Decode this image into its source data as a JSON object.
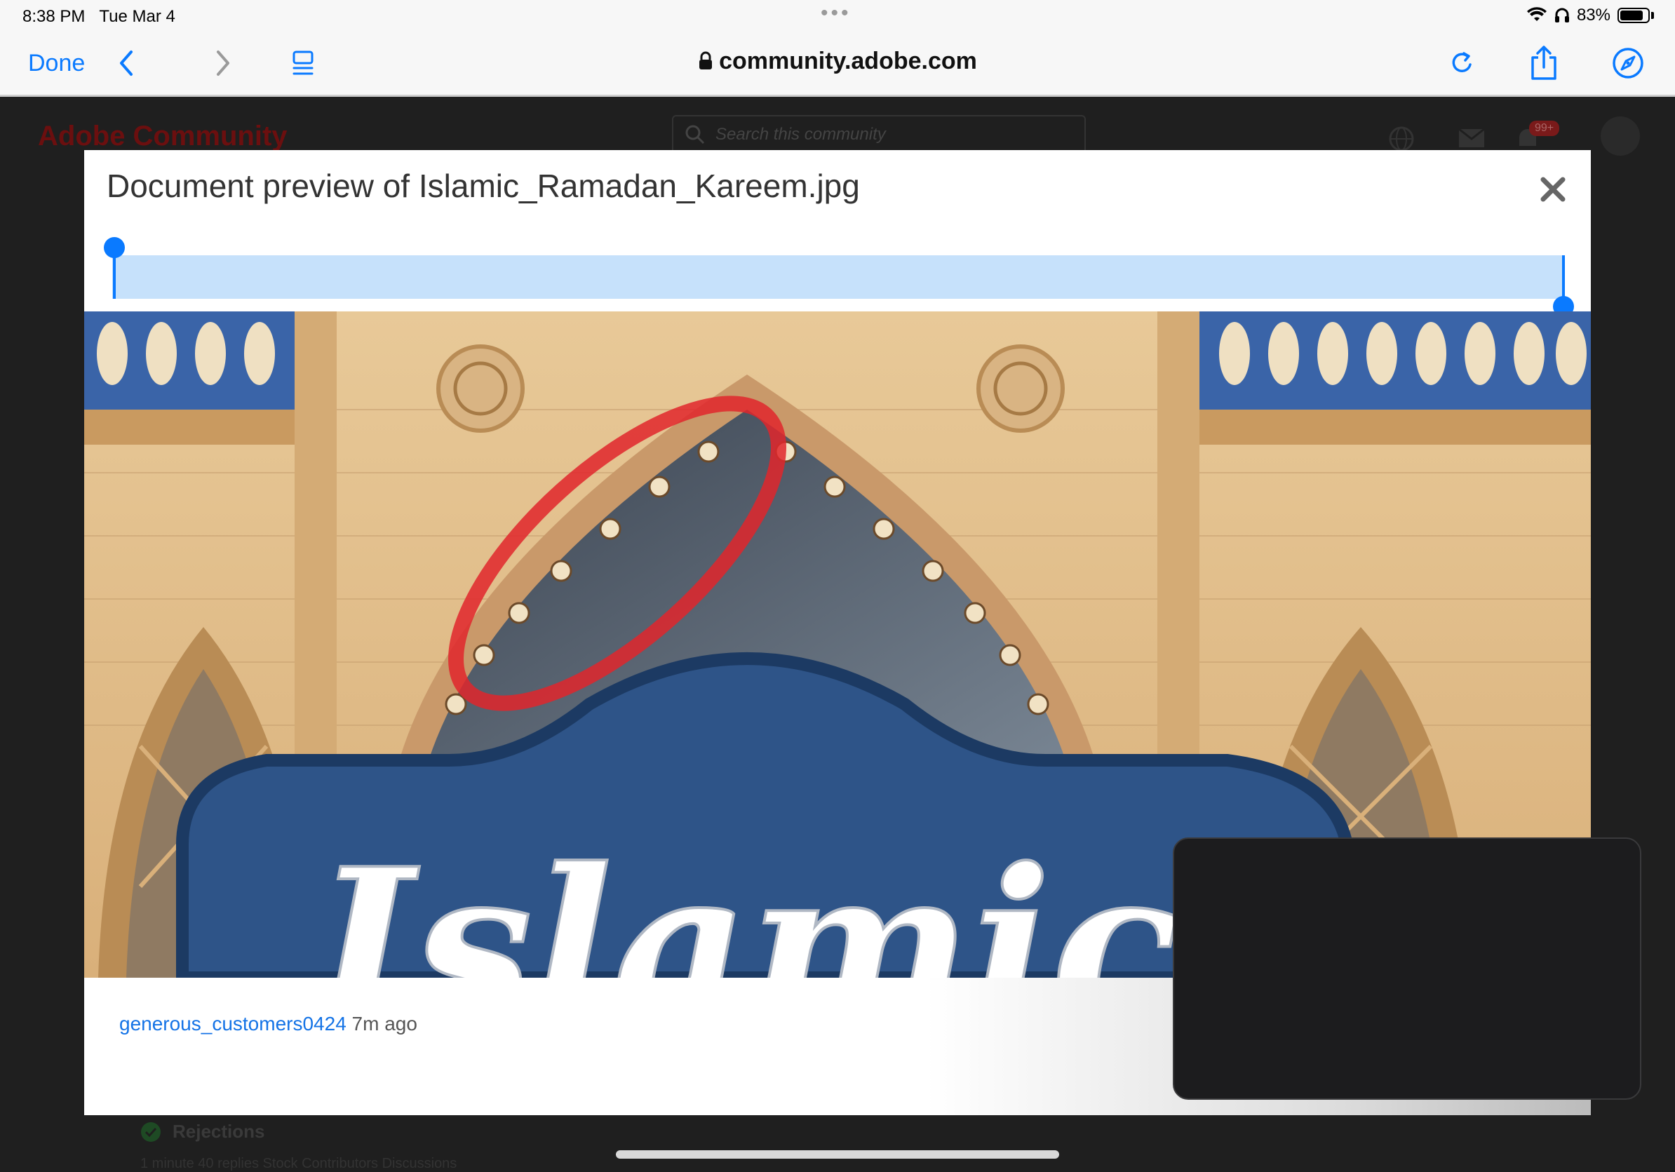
{
  "status_bar": {
    "time": "8:38 PM",
    "date": "Tue Mar 4",
    "battery": "83%",
    "battery_level": 0.83
  },
  "toolbar": {
    "done_label": "Done",
    "url": "community.adobe.com",
    "icons": [
      "back-chevron-icon",
      "forward-chevron-icon",
      "tab-overview-icon",
      "lock-icon",
      "reload-icon",
      "share-icon",
      "compass-icon"
    ]
  },
  "background_page": {
    "logo": "Adobe Community",
    "search_placeholder": "Search this community",
    "notification_badge": "99+",
    "rejections_label": "Rejections",
    "meta": "1 minute   40 replies   Stock Contributors Discussions"
  },
  "modal": {
    "title": "Document preview of Islamic_Ramadan_Kareem.jpg",
    "image_text": "Islamic",
    "author": "generous_customers0424",
    "time_ago": "7m ago"
  },
  "colors": {
    "accent": "#0a7aff",
    "selection": "#c6e1fb",
    "link": "#1473e6",
    "annotation": "#e0262b"
  }
}
